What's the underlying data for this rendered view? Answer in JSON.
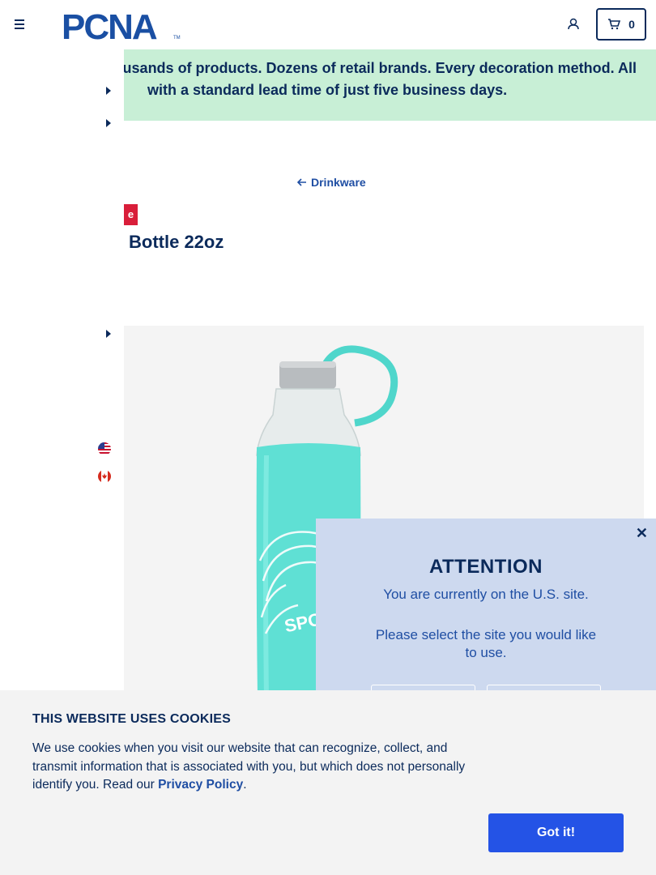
{
  "header": {
    "logo_text": "PCNA",
    "cart_count": "0"
  },
  "banner": {
    "line1": "usands of products. Dozens of retail brands. Every decoration method. All",
    "line2": "with a standard lead time of just five business days."
  },
  "breadcrumb": {
    "label": "Drinkware"
  },
  "product": {
    "tag": "e",
    "title": "Bottle 22oz",
    "imprint_text": "SPO"
  },
  "site_modal": {
    "close": "✕",
    "heading": "ATTENTION",
    "message": "You are currently on the U.S. site.",
    "prompt": "Please select the site you would like to use."
  },
  "cookie_banner": {
    "heading": "THIS WEBSITE USES COOKIES",
    "body": "We use cookies when you visit our website that can recognize, collect, and transmit information that is associated with you, but which does not personally identify you. Read our ",
    "link": "Privacy Policy",
    "end": ".",
    "button": "Got it!"
  },
  "colors": {
    "navy": "#0b2a5b",
    "banner_green": "#c8efd6",
    "accent_red": "#d91e3a",
    "button_blue": "#2453e6",
    "modal_bg": "#cdd9ef",
    "bottle_teal": "#5fe0d4"
  }
}
